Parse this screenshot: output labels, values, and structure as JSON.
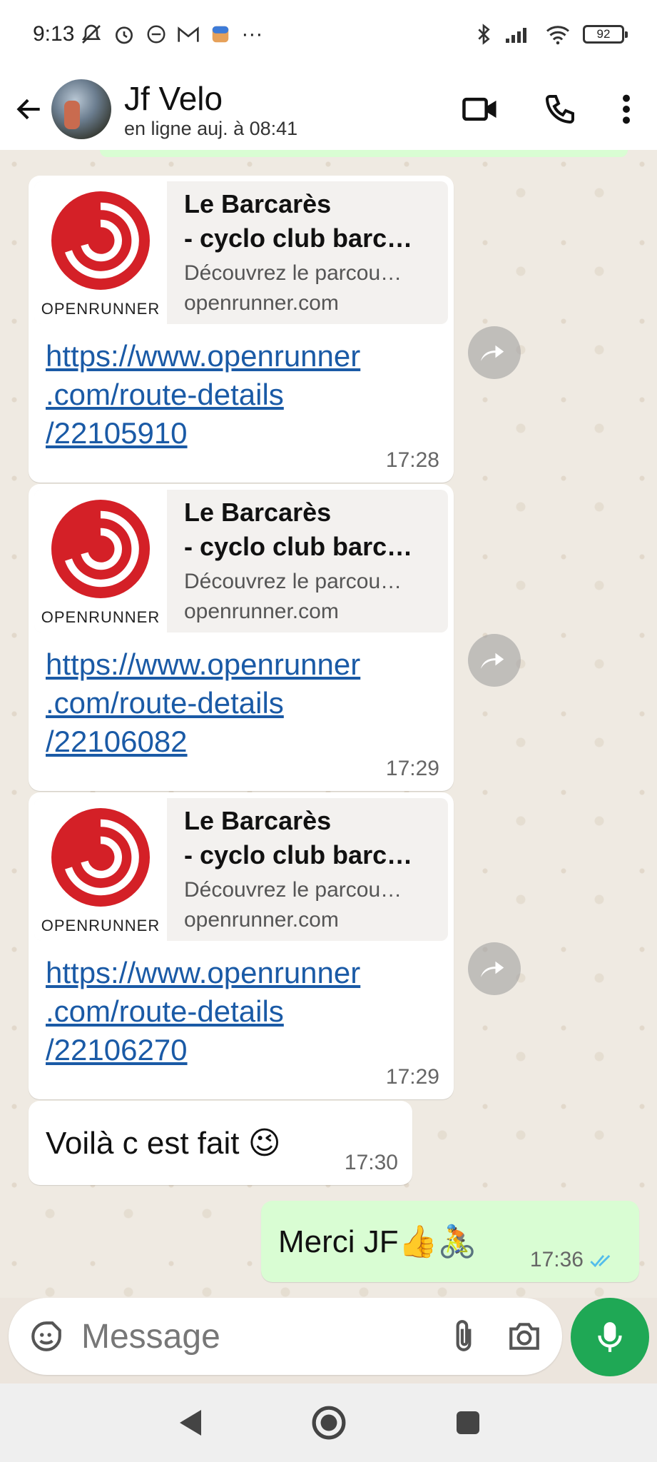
{
  "status_bar": {
    "time": "9:13",
    "dots": "···",
    "battery": "92"
  },
  "header": {
    "contact_name": "Jf Velo",
    "contact_status": "en ligne auj. à 08:41"
  },
  "messages": [
    {
      "preview_title_1": "Le Barcarès",
      "preview_title_2": "- cyclo club barc…",
      "preview_desc": "Découvrez le parcou…",
      "preview_domain": "openrunner.com",
      "logo_text": "OPENRUNNER",
      "url_1": "https://www.openrunner",
      "url_2": ".com/route-details",
      "url_3": "/22105910",
      "time": "17:28"
    },
    {
      "preview_title_1": "Le Barcarès",
      "preview_title_2": "- cyclo club barc…",
      "preview_desc": "Découvrez le parcou…",
      "preview_domain": "openrunner.com",
      "logo_text": "OPENRUNNER",
      "url_1": "https://www.openrunner",
      "url_2": ".com/route-details",
      "url_3": "/22106082",
      "time": "17:29"
    },
    {
      "preview_title_1": "Le Barcarès",
      "preview_title_2": "- cyclo club barc…",
      "preview_desc": "Découvrez le parcou…",
      "preview_domain": "openrunner.com",
      "logo_text": "OPENRUNNER",
      "url_1": "https://www.openrunner",
      "url_2": ".com/route-details",
      "url_3": "/22106270",
      "time": "17:29"
    }
  ],
  "text_message_in": {
    "text": "Voilà c est fait 😉",
    "time": "17:30"
  },
  "text_message_out": {
    "text": "Merci JF👍🚴",
    "time": "17:36"
  },
  "composer": {
    "placeholder": "Message"
  },
  "colors": {
    "accent_green": "#1fa855",
    "outgoing_bubble": "#d9fdd3",
    "link": "#1a5aa6",
    "read_receipt": "#53bdeb"
  }
}
